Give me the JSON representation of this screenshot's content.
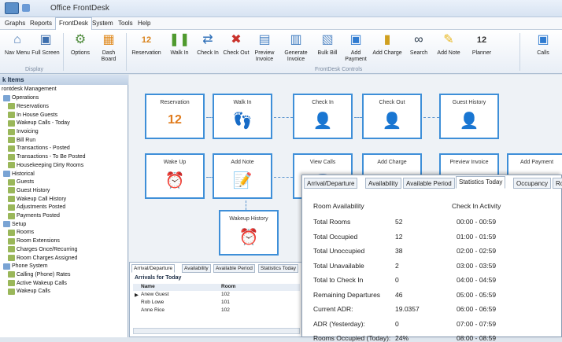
{
  "window": {
    "title": "Office FrontDesk"
  },
  "menu": [
    "Graphs",
    "Reports",
    "FrontDesk",
    "System",
    "Tools",
    "Help"
  ],
  "ribbon": {
    "display_items": [
      {
        "label": "Nav Menu",
        "icon": "home-icon"
      },
      {
        "label": "Full Screen",
        "icon": "fullscreen-icon"
      }
    ],
    "options_items": [
      {
        "label": "Options",
        "icon": "gear-icon"
      },
      {
        "label": "Dash Board",
        "icon": "dashboard-icon"
      }
    ],
    "controls_items": [
      {
        "label": "Reservation",
        "icon": "calendar-icon"
      },
      {
        "label": "Walk In",
        "icon": "footprints-icon"
      },
      {
        "label": "Check In",
        "icon": "arrow-in-icon"
      },
      {
        "label": "Check Out",
        "icon": "arrow-out-icon"
      },
      {
        "label": "Preview Invoice",
        "icon": "invoice-icon"
      },
      {
        "label": "Generate Invoice",
        "icon": "generate-invoice-icon"
      },
      {
        "label": "Bulk Bill",
        "icon": "bulk-bill-icon"
      },
      {
        "label": "Add Payment",
        "icon": "payment-icon"
      },
      {
        "label": "Add Charge",
        "icon": "charge-icon"
      },
      {
        "label": "Search",
        "icon": "binoculars-icon"
      },
      {
        "label": "Add Note",
        "icon": "note-icon"
      },
      {
        "label": "Planner",
        "icon": "planner-icon"
      },
      {
        "label": "Calls",
        "icon": "calls-icon"
      }
    ],
    "group_display": "Display",
    "group_controls": "FrontDesk Controls",
    "planner_day": "12"
  },
  "sidebar": {
    "header": "k Items",
    "items": [
      {
        "label": "rontdesk Management",
        "level": 0
      },
      {
        "label": "Operations",
        "level": 1
      },
      {
        "label": "Reservations",
        "level": 2
      },
      {
        "label": "In House Guests",
        "level": 2
      },
      {
        "label": "Wakeup Calls - Today",
        "level": 2
      },
      {
        "label": "Invoicing",
        "level": 2
      },
      {
        "label": "Bill Run",
        "level": 2
      },
      {
        "label": "Transactions - Posted",
        "level": 2
      },
      {
        "label": "Transactions - To Be Posted",
        "level": 2
      },
      {
        "label": "Housekeeping Dirty Rooms",
        "level": 2
      },
      {
        "label": "Historical",
        "level": 1
      },
      {
        "label": "Guests",
        "level": 2
      },
      {
        "label": "Guest History",
        "level": 2
      },
      {
        "label": "Wakeup Call History",
        "level": 2
      },
      {
        "label": "Adjustments Posted",
        "level": 2
      },
      {
        "label": "Payments Posted",
        "level": 2
      },
      {
        "label": "Setup",
        "level": 1
      },
      {
        "label": "Rooms",
        "level": 2
      },
      {
        "label": "Room Extensions",
        "level": 2
      },
      {
        "label": "Charges Once/Recurring",
        "level": 2
      },
      {
        "label": "Room Charges Assigned",
        "level": 2
      },
      {
        "label": "Phone System",
        "level": 1
      },
      {
        "label": "Calling (Phone) Rates",
        "level": 2
      },
      {
        "label": "Active Wakeup Calls",
        "level": 2
      },
      {
        "label": "Wakeup Calls",
        "level": 2
      }
    ]
  },
  "tiles": [
    {
      "label": "Reservation",
      "icon": "calendar-icon",
      "glyph": "12"
    },
    {
      "label": "Walk In",
      "icon": "footprints-icon",
      "glyph": "👣"
    },
    {
      "label": "Check In",
      "icon": "person-check-in-icon",
      "glyph": "👤"
    },
    {
      "label": "Check Out",
      "icon": "person-check-out-icon",
      "glyph": "👤"
    },
    {
      "label": "Guest History",
      "icon": "person-history-icon",
      "glyph": "👤"
    },
    {
      "label": "Wake Up",
      "icon": "alarm-clock-icon",
      "glyph": "⏰"
    },
    {
      "label": "Add Note",
      "icon": "note-icon",
      "glyph": "📝"
    },
    {
      "label": "View Calls",
      "icon": "calls-icon",
      "glyph": "☎"
    },
    {
      "label": "Add Charge",
      "icon": "charge-icon",
      "glyph": "▦"
    },
    {
      "label": "Preview Invoice",
      "icon": "invoice-icon",
      "glyph": "▤"
    },
    {
      "label": "Add Payment",
      "icon": "payment-icon",
      "glyph": "▣"
    },
    {
      "label": "Wakeup History",
      "icon": "alarm-history-icon",
      "glyph": "⏰"
    }
  ],
  "bottom_panel": {
    "tabs": [
      "Arrival/Departure",
      "Availability",
      "Available Period",
      "Statistics Today"
    ],
    "title": "Arrivals for Today",
    "columns": [
      "Name",
      "Room"
    ],
    "rows": [
      {
        "name": "Anew Guest",
        "room": "102"
      },
      {
        "name": "Rob Lowe",
        "room": "101"
      },
      {
        "name": "Anne Rice",
        "room": "102"
      }
    ]
  },
  "stats_panel": {
    "tabs": [
      "Arrival/Departure",
      "Availability",
      "Available Period",
      "Statistics Today",
      "Occupancy",
      "Ro"
    ],
    "left_header": "Room Availability",
    "right_header": "Check In Activity",
    "rows": [
      {
        "label": "Total Rooms",
        "value": "52",
        "time": "00:00 - 00:59"
      },
      {
        "label": "Total Occupied",
        "value": "12",
        "time": "01:00 - 01:59"
      },
      {
        "label": "Total Unoccupied",
        "value": "38",
        "time": "02:00 - 02:59"
      },
      {
        "label": "Total Unavailable",
        "value": "2",
        "time": "03:00 - 03:59"
      },
      {
        "label": "Total to Check In",
        "value": "0",
        "time": "04:00 - 04:59"
      },
      {
        "label": "Remaining Departures",
        "value": "46",
        "time": "05:00 - 05:59"
      },
      {
        "label": "Current ADR:",
        "value": "19.0357",
        "time": "06:00 - 06:59"
      },
      {
        "label": "ADR (Yesterday):",
        "value": "0",
        "time": "07:00 - 07:59"
      },
      {
        "label": "Rooms Occupied (Today):",
        "value": "24%",
        "time": "08:00 - 08:59"
      }
    ]
  }
}
